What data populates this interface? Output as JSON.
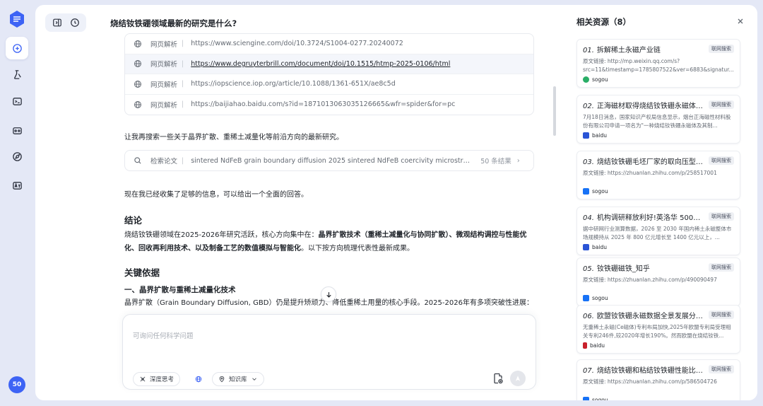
{
  "rail": {
    "credits": "50"
  },
  "chat": {
    "title": "烧结钕铁硼领域最新的研究是什么?",
    "links": [
      {
        "label": "网页解析",
        "url": "https://www.sciengine.com/doi/10.3724/S1004-0277.20240072",
        "highlight": false
      },
      {
        "label": "网页解析",
        "url": "https://www.degruyterbrill.com/document/doi/10.1515/htmp-2025-0106/html",
        "highlight": true
      },
      {
        "label": "网页解析",
        "url": "https://iopscience.iop.org/article/10.1088/1361-651X/ae8c5d",
        "highlight": false
      },
      {
        "label": "网页解析",
        "url": "https://baijiahao.baidu.com/s?id=1871013063035126665&wfr=spider&for=pc",
        "highlight": false
      }
    ],
    "para1": "让我再搜索一些关于晶界扩散、重稀土减量化等前沿方向的最新研究。",
    "search": {
      "label": "检索论文",
      "query": "sintered NdFeB grain boundary diffusion 2025 sintered NdFeB coercivity microstructure",
      "count": "50 条结果"
    },
    "para2": "现在我已经收集了足够的信息，可以给出一个全面的回答。",
    "conclusion_heading": "结论",
    "conclusion_prefix": "烧结钕铁硼领域在2025-2026年研究活跃，核心方向集中在：",
    "conclusion_bold": "晶界扩散技术（重稀土减量化与协同扩散）、微观结构调控与性能优化、回收再利用技术、以及制备工艺的数值模拟与智能化",
    "conclusion_suffix": "。以下按方向梳理代表性最新成果。",
    "basis_heading": "关键依据",
    "basis_sub": "一、晶界扩散与重稀土减量化技术",
    "basis_text": "晶界扩散（Grain Boundary Diffusion, GBD）仍是提升矫顽力、降低重稀土用量的核心手段。2025-2026年有多项突破性进展："
  },
  "input": {
    "placeholder": "可询问任何科学问题",
    "deep_think": "深度思考",
    "knowledge_base": "知识库"
  },
  "resources": {
    "title": "相关资源（8）",
    "items": [
      {
        "num": "01.",
        "title": "拆解稀土永磁产业链",
        "tag": "联网搜索",
        "desc": "原文链接: http://mp.weixin.qq.com/s?src=11&timestamp=1785807522&ver=6883&signatur...",
        "source": "sogou",
        "src_color": "#2aae67"
      },
      {
        "num": "02.",
        "title": "正海磁材取得烧结钕铁硼永磁体相关专利",
        "tag": "联网搜索",
        "desc": "7月18日消息，国家知识产权局信息显示，烟台正海磁性材料股份有限公司申请一项名为\"一种烧结钕铁硼永磁体及其制...",
        "source": "baidu",
        "src_color": "#2a54d6"
      },
      {
        "num": "03.",
        "title": "烧结钕铁硼毛坯厂家的取向压型技术",
        "tag": "联网搜索",
        "desc": "原文链接: https://zhuanlan.zhihu.com/p/258517001",
        "source": "sogou",
        "src_color": "#1772f6"
      },
      {
        "num": "04.",
        "title": "机构调研释放利好!英洛华 5000 吨高性能烧结钕铁硼",
        "tag": "联网搜索",
        "desc": "据中研网行业测算数据，2026 至 2030 年国内稀土永磁整体市场规模持从 2025 年 800 亿元增长至 1400 亿元以上，...",
        "source": "baidu",
        "src_color": "#2a54d6"
      },
      {
        "num": "05.",
        "title": "钕铁硼磁铁_知乎",
        "tag": "联网搜索",
        "desc": "原文链接: https://zhuanlan.zhihu.com/p/490090497",
        "source": "sogou",
        "src_color": "#1772f6"
      },
      {
        "num": "06.",
        "title": "欧盟钕铁硼永磁数据全景发展分析报告",
        "tag": "联网搜索",
        "desc": "无重稀土永磁(Ce磁体)专利布局加快,2025年欧盟专利局受理相关专利246件,较2020年增长190%。然而欧盟在烧结钕铁...",
        "source": "baidu",
        "src_color": "#c8202b"
      },
      {
        "num": "07.",
        "title": "烧结钕铁硼和粘结钕铁硼性能比较_知乎",
        "tag": "联网搜索",
        "desc": "原文链接: https://zhuanlan.zhihu.com/p/586504726",
        "source": "sogou",
        "src_color": "#1772f6"
      }
    ]
  }
}
